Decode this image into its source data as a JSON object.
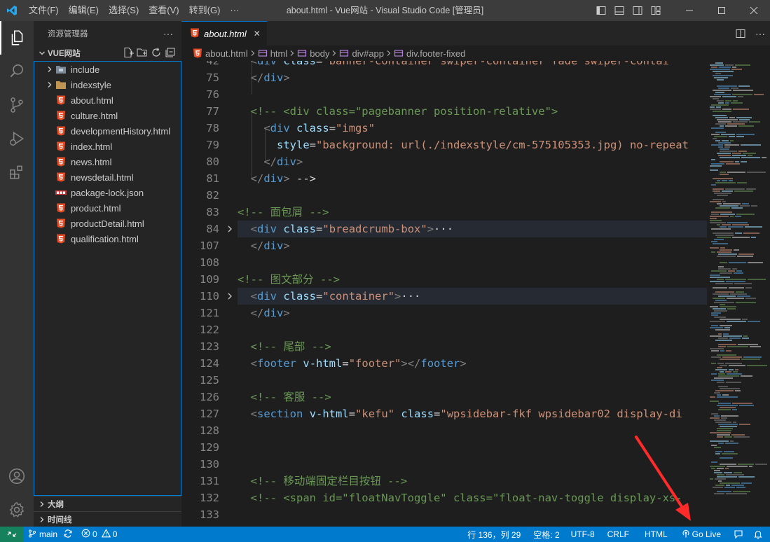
{
  "titlebar": {
    "menu": [
      "文件(F)",
      "编辑(E)",
      "选择(S)",
      "查看(V)",
      "转到(G)",
      "···"
    ],
    "title": "about.html - Vue网站 - Visual Studio Code [管理员]"
  },
  "sidebar": {
    "header": "资源管理器",
    "header_more": "···",
    "root_folder": "VUE网站",
    "items": [
      {
        "label": "include",
        "type": "folder"
      },
      {
        "label": "indexstyle",
        "type": "folder"
      },
      {
        "label": "about.html",
        "type": "html"
      },
      {
        "label": "culture.html",
        "type": "html"
      },
      {
        "label": "developmentHistory.html",
        "type": "html"
      },
      {
        "label": "index.html",
        "type": "html"
      },
      {
        "label": "news.html",
        "type": "html"
      },
      {
        "label": "newsdetail.html",
        "type": "html"
      },
      {
        "label": "package-lock.json",
        "type": "npm"
      },
      {
        "label": "product.html",
        "type": "html"
      },
      {
        "label": "productDetail.html",
        "type": "html"
      },
      {
        "label": "qualification.html",
        "type": "html"
      }
    ],
    "outline": "大纲",
    "timeline": "时间线"
  },
  "tab": {
    "label": "about.html",
    "close": "✕"
  },
  "breadcrumb": [
    "about.html",
    "html",
    "body",
    "div#app",
    "div.footer-fixed"
  ],
  "editor": {
    "lines": [
      {
        "n": "42",
        "text": "  <div class=\"banner-container swiper-container fade swiper-contai"
      },
      {
        "n": "75",
        "text": "  </div>"
      },
      {
        "n": "76",
        "text": ""
      },
      {
        "n": "77",
        "text": "  <!-- <div class=\"pagebanner position-relative\">"
      },
      {
        "n": "78",
        "text": "    <div class=\"imgs\""
      },
      {
        "n": "79",
        "text": "      style=\"background: url(./indexstyle/cm-575105353.jpg) no-repeat"
      },
      {
        "n": "80",
        "text": "    </div>"
      },
      {
        "n": "81",
        "text": "  </div> -->"
      },
      {
        "n": "82",
        "text": ""
      },
      {
        "n": "83",
        "text": "<!-- 面包屑 -->"
      },
      {
        "n": "84",
        "text": "  <div class=\"breadcrumb-box\">···"
      },
      {
        "n": "107",
        "text": "  </div>"
      },
      {
        "n": "108",
        "text": ""
      },
      {
        "n": "109",
        "text": "<!-- 图文部分 -->"
      },
      {
        "n": "110",
        "text": "  <div class=\"container\">···"
      },
      {
        "n": "121",
        "text": "  </div>"
      },
      {
        "n": "122",
        "text": ""
      },
      {
        "n": "123",
        "text": "  <!-- 尾部 -->"
      },
      {
        "n": "124",
        "text": "  <footer v-html=\"footer\"></footer>"
      },
      {
        "n": "125",
        "text": ""
      },
      {
        "n": "126",
        "text": "  <!-- 客服 -->"
      },
      {
        "n": "127",
        "text": "  <section v-html=\"kefu\" class=\"wpsidebar-fkf wpsidebar02 display-di"
      },
      {
        "n": "128",
        "text": ""
      },
      {
        "n": "129",
        "text": ""
      },
      {
        "n": "130",
        "text": ""
      },
      {
        "n": "131",
        "text": "  <!-- 移动端固定栏目按钮 -->"
      },
      {
        "n": "132",
        "text": "  <!-- <span id=\"floatNavToggle\" class=\"float-nav-toggle display-xs-"
      },
      {
        "n": "133",
        "text": ""
      }
    ]
  },
  "statusbar": {
    "branch": "main",
    "errors": "0",
    "warnings": "0",
    "position": "行 136，列 29",
    "spaces": "空格: 2",
    "encoding": "UTF-8",
    "eol": "CRLF",
    "language": "HTML",
    "golive": "Go Live"
  },
  "colors": {
    "accent": "#007acc",
    "html_icon": "#e44d26",
    "annotation_arrow": "#ff2a2a"
  }
}
